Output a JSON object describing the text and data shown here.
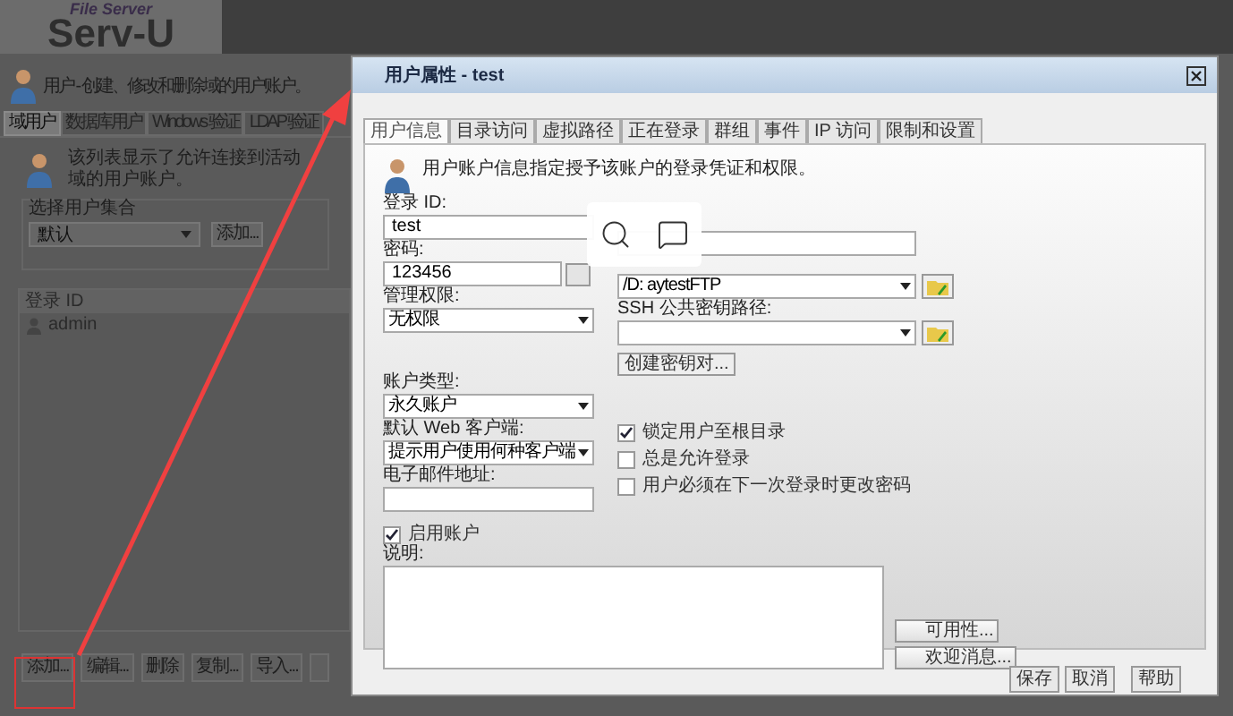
{
  "app": {
    "logo_caption": "File Server",
    "logo": "Serv-U",
    "header": "用户 - 创建、修改和删除域的用户账户。",
    "tabs": [
      {
        "label": "域用户",
        "selected": true
      },
      {
        "label": "数据库用户",
        "selected": false
      },
      {
        "label": "Windows 验证",
        "selected": false
      },
      {
        "label": "LDAP 验证",
        "selected": false
      }
    ],
    "list_info": "该列表显示了允许连接到活动域的用户账户。",
    "collection": {
      "legend": "选择用户集合",
      "value": "默认",
      "button": "添加..."
    },
    "list": {
      "column": "登录 ID",
      "rows": [
        {
          "login": "admin"
        }
      ]
    },
    "buttons": [
      "添加...",
      "编辑...",
      "删除",
      "复制...",
      "导入..."
    ]
  },
  "dialog": {
    "title": "用户属性 - test",
    "tabs": [
      {
        "label": "用户信息",
        "selected": true
      },
      {
        "label": "目录访问",
        "selected": false
      },
      {
        "label": "虚拟路径",
        "selected": false
      },
      {
        "label": "正在登录",
        "selected": false
      },
      {
        "label": "群组",
        "selected": false
      },
      {
        "label": "事件",
        "selected": false
      },
      {
        "label": "IP 访问",
        "selected": false
      },
      {
        "label": "限制和设置",
        "selected": false
      }
    ],
    "description": "用户账户信息指定授予该账户的登录凭证和权限。",
    "login_id": {
      "label": "登录 ID:",
      "value": "test"
    },
    "password": {
      "label": "密码:",
      "value": "123456"
    },
    "admin": {
      "label": "管理权限:",
      "value": "无权限"
    },
    "account_type": {
      "label": "账户类型:",
      "value": "永久账户"
    },
    "web_client": {
      "label": "默认 Web 客户端:",
      "value": "提示用户使用何种客户端"
    },
    "email": {
      "label": "电子邮件地址:"
    },
    "home_dir": {
      "value": "/D:   aytestFTP"
    },
    "ssh": {
      "label": "SSH 公共密钥路径:"
    },
    "keypair_button": "创建密钥对...",
    "options": [
      {
        "label": "锁定用户至根目录",
        "checked": true
      },
      {
        "label": "总是允许登录",
        "checked": false
      },
      {
        "label": "用户必须在下一次登录时更改密码",
        "checked": false
      }
    ],
    "enabled": {
      "label": "启用账户",
      "checked": true
    },
    "notes": {
      "label": "说明:"
    },
    "side_buttons": [
      "可用性...",
      "欢迎消息..."
    ],
    "buttons": [
      "保存",
      "取消",
      "帮助"
    ]
  }
}
